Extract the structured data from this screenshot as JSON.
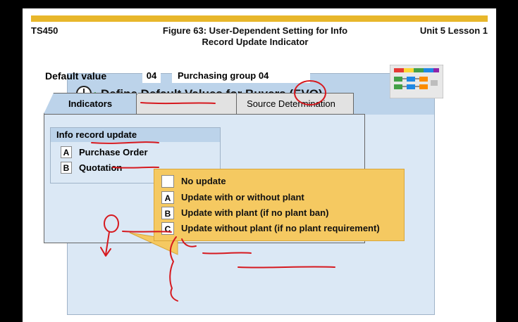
{
  "header": {
    "course": "TS450",
    "figure_line1": "Figure 63: User-Dependent Setting for Info",
    "figure_line2": "Record Update Indicator",
    "unit": "Unit 5 Lesson 1"
  },
  "dialog": {
    "title": "Define Default Values for Buyers (EVO)",
    "default_value_label": "Default value",
    "default_value_code": "04",
    "default_value_text": "Purchasing group 04"
  },
  "tabs": [
    {
      "label": "Indicators",
      "active": true
    },
    {
      "label": "",
      "active": false
    },
    {
      "label": "Source Determination",
      "active": false
    }
  ],
  "info_record": {
    "title": "Info record update",
    "options": [
      {
        "code": "A",
        "label": "Purchase Order"
      },
      {
        "code": "B",
        "label": "Quotation"
      }
    ]
  },
  "callout": {
    "options": [
      {
        "code": "",
        "label": "No update"
      },
      {
        "code": "A",
        "label": "Update with or without plant"
      },
      {
        "code": "B",
        "label": "Update with plant (if no plant ban)"
      },
      {
        "code": "C",
        "label": "Update without plant (if no plant requirement)"
      }
    ]
  },
  "colors": {
    "gold": "#e8b72b",
    "panel_blue": "#bcd3ea",
    "body_blue": "#dbe8f5",
    "callout_yellow": "#f5c961",
    "ink_red": "#d6191f"
  },
  "icons": [
    "clock-check-icon",
    "evo-logo-icon"
  ]
}
